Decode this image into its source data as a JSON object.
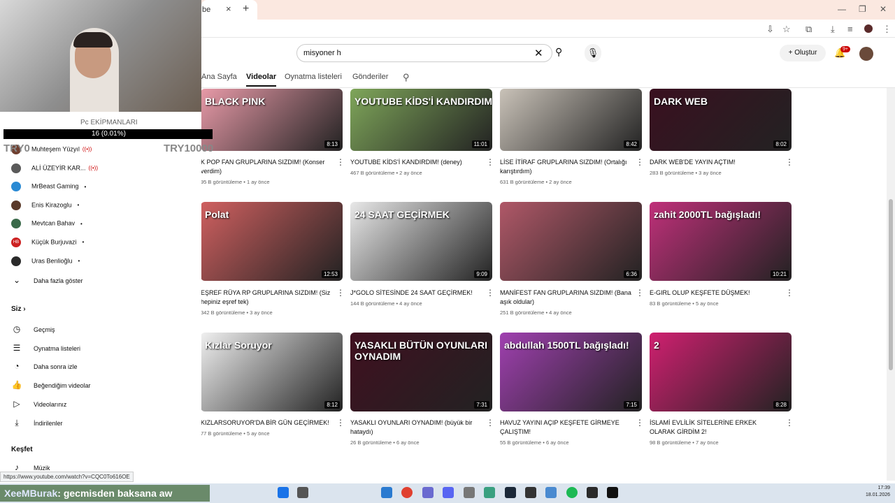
{
  "browser": {
    "tab_title": "be",
    "close": "×",
    "new_tab": "+",
    "controls": [
      "—",
      "❐",
      "✕"
    ]
  },
  "search": {
    "value": "misyoner h",
    "clear": "✕",
    "icon": "search-icon"
  },
  "header": {
    "create_label": "Oluştur",
    "notif_badge": "9+"
  },
  "channel_tabs": [
    "Ana Sayfa",
    "Videolar",
    "Oynatma listeleri",
    "Gönderiler"
  ],
  "videos": [
    {
      "title": "K POP FAN GRUPLARINA SIZDIM! (Konser verdim)",
      "meta": "95 B görüntüleme • 1 ay önce",
      "duration": "8:13",
      "color": "#e89aa8"
    },
    {
      "title": "YOUTUBE KİDS'İ KANDIRDIM! (deney)",
      "meta": "467 B görüntüleme • 2 ay önce",
      "duration": "11:01",
      "color": "#7fa65a"
    },
    {
      "title": "LİSE İTİRAF GRUPLARINA SIZDIM! (Ortalığı karıştırdım)",
      "meta": "631 B görüntüleme • 2 ay önce",
      "duration": "8:42",
      "color": "#c9c2b8"
    },
    {
      "title": "DARK WEB'DE YAYIN AÇTIM!",
      "meta": "283 B görüntüleme • 3 ay önce",
      "duration": "8:02",
      "color": "#3a1020"
    },
    {
      "title": "EŞREF RÜYA RP GRUPLARINA SIZDIM! (Siz hepiniz eşref tek)",
      "meta": "342 B görüntüleme • 3 ay önce",
      "duration": "12:53",
      "color": "#d06060"
    },
    {
      "title": "J*GOLO SİTESİNDE 24 SAAT GEÇİRMEK!",
      "meta": "144 B görüntüleme • 4 ay önce",
      "duration": "9:09",
      "color": "#e8e8e8"
    },
    {
      "title": "MANİFEST FAN GRUPLARINA SIZDIM! (Bana aşık oldular)",
      "meta": "251 B görüntüleme • 4 ay önce",
      "duration": "6:36",
      "color": "#b05868"
    },
    {
      "title": "E-GIRL OLUP KEŞFETE DÜŞMEK!",
      "meta": "83 B görüntüleme • 5 ay önce",
      "duration": "10:21",
      "color": "#c0307a"
    },
    {
      "title": "KIZLARSORUYOR'DA BİR GÜN GEÇİRMEK!",
      "meta": "77 B görüntüleme • 5 ay önce",
      "duration": "8:12",
      "color": "#f0f0f0"
    },
    {
      "title": "YASAKLI OYUNLARI OYNADIM! (büyük bir hataydı)",
      "meta": "26 B görüntüleme • 6 ay önce",
      "duration": "7:31",
      "color": "#401020"
    },
    {
      "title": "HAVUZ YAYINI AÇIP KEŞFETE GİRMEYE ÇALIŞTIM!",
      "meta": "55 B görüntüleme • 6 ay önce",
      "duration": "7:15",
      "color": "#a040b0"
    },
    {
      "title": "İSLAMİ EVLİLİK SİTELERİNE ERKEK OLARAK GİRDİM 2!",
      "meta": "98 B görüntüleme • 7 ay önce",
      "duration": "8:28",
      "color": "#d02070"
    }
  ],
  "thumb_texts": [
    "BLACK PINK",
    "YOUTUBE KİDS'İ KANDIRDIM",
    "",
    "DARK WEB",
    "Polat",
    "24 SAAT GEÇİRMEK",
    "",
    "zahit 2000TL bağışladı!",
    "Kızlar Soruyor",
    "YASAKLI BÜTÜN OYUNLARI OYNADIM",
    "abdullah 1500TL bağışladı!",
    "2"
  ],
  "overlay": {
    "pc_label": "Pc EKİPMANLARI",
    "donation": "16 (0.01%)",
    "try_left": "TRY0",
    "try_right": "TRY10000"
  },
  "subs": [
    {
      "name": "Muhteşem Yüzyıl",
      "live": true,
      "color": "#704030"
    },
    {
      "name": "ALİ ÜZEYİR KAR...",
      "live": true,
      "color": "#5a5a5a"
    },
    {
      "name": "MrBeast Gaming",
      "live": false,
      "color": "#2a8ad4"
    },
    {
      "name": "Enis Kirazoglu",
      "live": false,
      "color": "#5a3a2a"
    },
    {
      "name": "Mevtcan Bahav",
      "live": false,
      "color": "#3a6a4a"
    },
    {
      "name": "Küçük Burjuvazi",
      "live": false,
      "color": "#cc2020",
      "initials": "HB"
    },
    {
      "name": "Uras Benlioğlu",
      "live": false,
      "color": "#2a2a2a"
    }
  ],
  "sidebar": {
    "more": "Daha fazla göster",
    "siz": "Siz",
    "kesfet": "Keşfet",
    "items": [
      "Geçmiş",
      "Oynatma listeleri",
      "Daha sonra izle",
      "Beğendiğim videolar",
      "Videolarınız",
      "İndirilenler"
    ],
    "music": "Müzik"
  },
  "status_url": "https://www.youtube.com/watch?v=CQC0To616OE",
  "chat": {
    "user": "XeeMBurak",
    "message": ": gecmisden baksana aw"
  },
  "clock": {
    "time": "17:39",
    "date": "18.01.2026"
  }
}
